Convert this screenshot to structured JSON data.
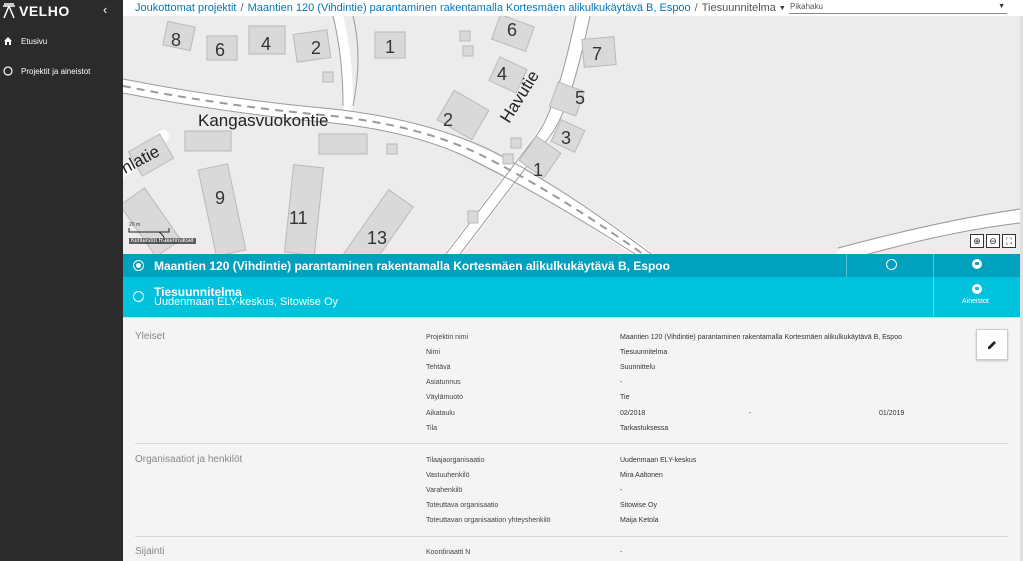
{
  "app": {
    "name": "VELHO",
    "collapse_icon": "chevron-left-icon"
  },
  "sidebar": {
    "items": [
      {
        "label": "Etusivu",
        "icon": "home-icon"
      },
      {
        "label": "Projektit ja aineistot",
        "icon": "circle-icon"
      }
    ]
  },
  "breadcrumb": {
    "items": [
      "Joukottomat projektit",
      "Maantien 120 (Vihdintie) parantaminen rakentamalla Kortesmäen alikulkukäytävä B, Espoo",
      "Tiesuunnitelma"
    ],
    "separator": "/"
  },
  "search": {
    "placeholder": "Pikahaku"
  },
  "map": {
    "street_labels": [
      "Kangasvuokontie",
      "Havutie",
      "nlatie"
    ],
    "house_numbers": [
      "8",
      "6",
      "4",
      "2",
      "1",
      "6",
      "7",
      "4",
      "5",
      "2",
      "3",
      "1",
      "9",
      "11",
      "13"
    ],
    "scale_label": "20 m",
    "attribution": "Kiinteistöt  Rakennukset",
    "colors": {
      "background": "#ececec",
      "building": "#d7d7d7",
      "road": "#ffffff"
    }
  },
  "project": {
    "title": "Maantien 120 (Vihdintie) parantaminen rakentamalla Kortesmäen alikulkukäytävä B, Espoo",
    "sub_title": "Tiesuunnitelma",
    "sub_orgs": "Uudenmaan ELY-keskus, Sitowise Oy",
    "aineistot_label": "Aineistot",
    "colors": {
      "bar_primary": "#00a1bf",
      "bar_secondary": "#00c2dc"
    }
  },
  "details": {
    "sections": [
      {
        "title": "Yleiset",
        "rows": [
          {
            "label": "Projektin nimi",
            "value": "Maantien 120 (Vihdintie) parantaminen rakentamalla Kortesmäen alikulkukäytävä B, Espoo"
          },
          {
            "label": "Nimi",
            "value": "Tiesuunnitelma"
          },
          {
            "label": "Tehtävä",
            "value": "Suunnittelu"
          },
          {
            "label": "Asiatunnus",
            "value": "-"
          },
          {
            "label": "Väylämuoto",
            "value": "Tie"
          },
          {
            "label": "Aikataulu",
            "value": "02/2018",
            "mid": "-",
            "end": "01/2019"
          },
          {
            "label": "Tila",
            "value": "Tarkastuksessa"
          }
        ]
      },
      {
        "title": "Organisaatiot ja henkilöt",
        "rows": [
          {
            "label": "Tilaajaorganisaatio",
            "value": "Uudenmaan ELY-keskus"
          },
          {
            "label": "Vastuuhenkilö",
            "value": "Mira Aaltonen"
          },
          {
            "label": "Varahenkilö",
            "value": "-"
          },
          {
            "label": "Toteuttava organisaatio",
            "value": "Sitowise Oy"
          },
          {
            "label": "Toteuttavan organisaation yhteyshenkilö",
            "value": "Maija Ketola"
          }
        ]
      },
      {
        "title": "Sijainti",
        "rows": [
          {
            "label": "Koordinaatti N",
            "value": "-"
          }
        ]
      }
    ]
  }
}
